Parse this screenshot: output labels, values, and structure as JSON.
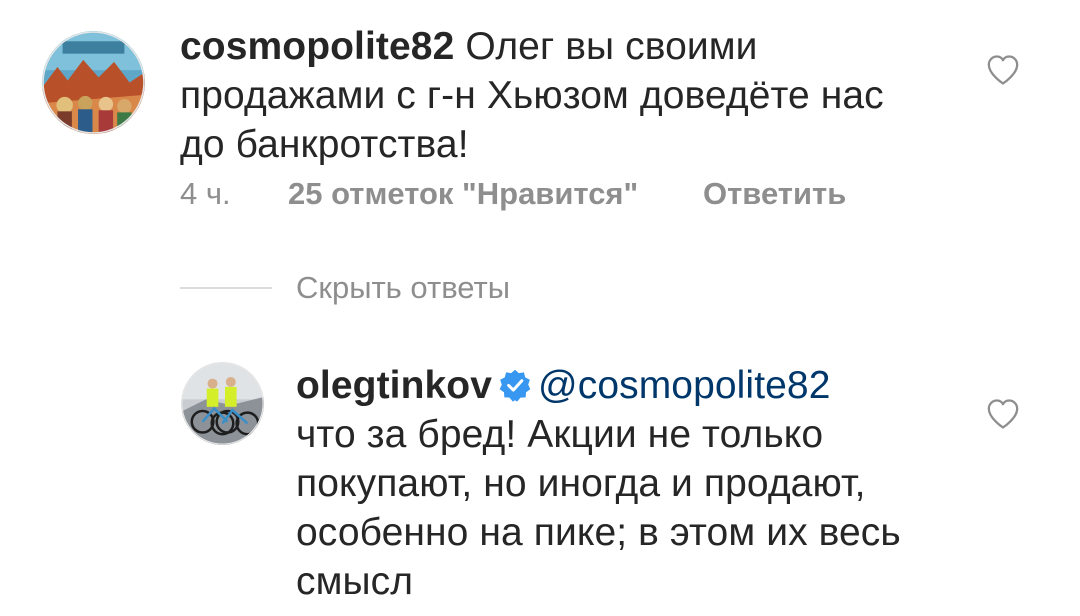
{
  "comment": {
    "username": "cosmopolite82",
    "text_line1": "Олег вы своими",
    "text_line2": "продажами с г-н Хьюзом доведёте нас",
    "text_line3": "до банкротства!",
    "time": "4 ч.",
    "likes": "25 отметок \"Нравится\"",
    "reply_label": "Ответить",
    "heart_icon": "heart-outline-icon"
  },
  "hide_replies_label": "Скрыть ответы",
  "reply": {
    "username": "olegtinkov",
    "verified_icon": "verified-badge-icon",
    "mention": "@cosmopolite82",
    "text_line1": "что за бред! Акции не только",
    "text_line2": "покупают, но иногда  и продают,",
    "text_line3": "особенно на пике; в этом их весь",
    "text_line4": "смысл",
    "heart_icon": "heart-outline-icon"
  },
  "colors": {
    "text": "#262626",
    "secondary": "#8e8e8e",
    "mention": "#00376b",
    "verified": "#3897f0",
    "divider": "#dbdbdb"
  }
}
